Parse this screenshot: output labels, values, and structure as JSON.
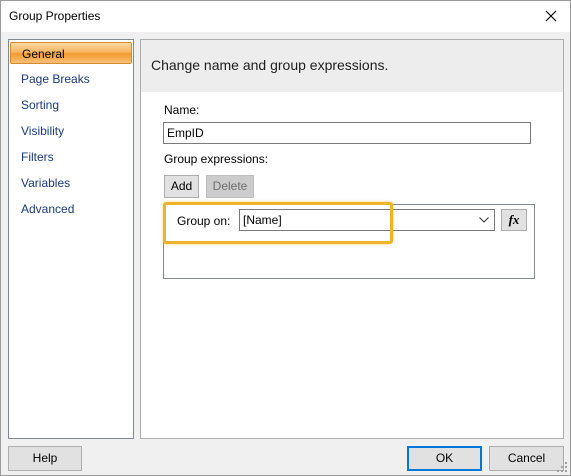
{
  "window": {
    "title": "Group Properties"
  },
  "nav": {
    "items": [
      {
        "label": "General",
        "selected": true
      },
      {
        "label": "Page Breaks",
        "selected": false
      },
      {
        "label": "Sorting",
        "selected": false
      },
      {
        "label": "Visibility",
        "selected": false
      },
      {
        "label": "Filters",
        "selected": false
      },
      {
        "label": "Variables",
        "selected": false
      },
      {
        "label": "Advanced",
        "selected": false
      }
    ]
  },
  "content": {
    "header": "Change name and group expressions.",
    "name_label": "Name:",
    "name_value": "EmpID",
    "group_expressions_label": "Group expressions:",
    "add_label": "Add",
    "delete_label": "Delete",
    "group_on_label": "Group on:",
    "group_on_value": "[Name]",
    "fx_label": "fx"
  },
  "footer": {
    "help_label": "Help",
    "ok_label": "OK",
    "cancel_label": "Cancel"
  },
  "colors": {
    "highlight": "#f0b429",
    "selected_nav": "#f7b560",
    "default_button_border": "#0078d7"
  },
  "icons": [
    "close-icon",
    "chevron-down-icon",
    "fx-icon",
    "resize-grip-icon"
  ]
}
